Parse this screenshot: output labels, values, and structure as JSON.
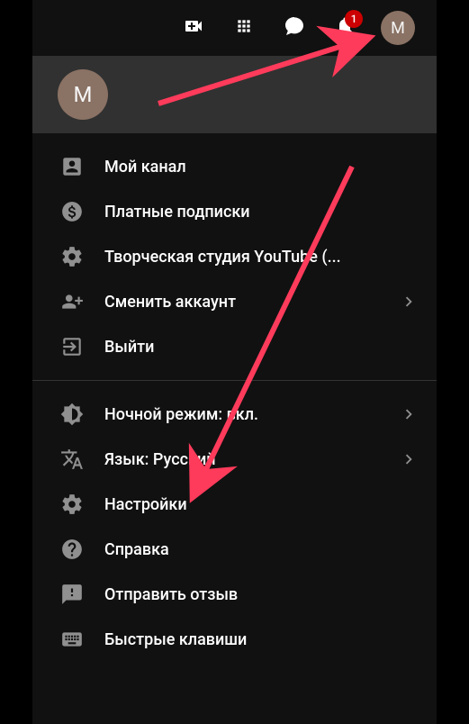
{
  "topbar": {
    "notification_count": "1",
    "avatar_initial": "M"
  },
  "account": {
    "avatar_initial": "M"
  },
  "menu": {
    "section1": [
      {
        "label": "Мой канал"
      },
      {
        "label": "Платные подписки"
      },
      {
        "label": "Творческая студия YouTube (..."
      },
      {
        "label": "Сменить аккаунт",
        "chevron": true
      },
      {
        "label": "Выйти"
      }
    ],
    "section2": [
      {
        "label": "Ночной режим: вкл.",
        "chevron": true
      },
      {
        "label": "Язык: Русский",
        "chevron": true
      },
      {
        "label": "Настройки"
      },
      {
        "label": "Справка"
      },
      {
        "label": "Отправить отзыв"
      },
      {
        "label": "Быстрые клавиши"
      }
    ]
  },
  "annotation": {
    "arrow_color": "#ff3b5b"
  }
}
